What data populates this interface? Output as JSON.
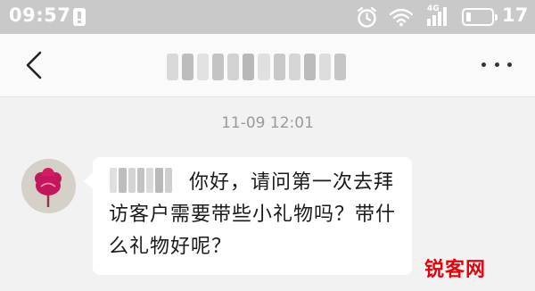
{
  "status_bar": {
    "time": "09:57",
    "network_label": "4G",
    "battery_percent": "17",
    "battery_level": 0.17,
    "icons": [
      "warning-icon",
      "alarm-icon",
      "wifi-icon",
      "signal-icon",
      "battery-icon"
    ]
  },
  "header": {
    "back_icon": "back-arrow-icon",
    "title_redacted": true,
    "more_icon": "more-dots-icon"
  },
  "chat": {
    "timestamp": "11-09 12:01",
    "messages": [
      {
        "sender_redacted": true,
        "text": "你好，请问第一次去拜访客户需要带些小礼物吗？带什么礼物好呢？"
      }
    ]
  },
  "watermark": {
    "text": "锐客网"
  },
  "colors": {
    "status_bar_bg": "#c9c9c9",
    "page_bg": "#f2f2f2",
    "bubble_bg": "#ffffff",
    "avatar_accent": "#c2185b",
    "watermark": "#e8000b"
  }
}
